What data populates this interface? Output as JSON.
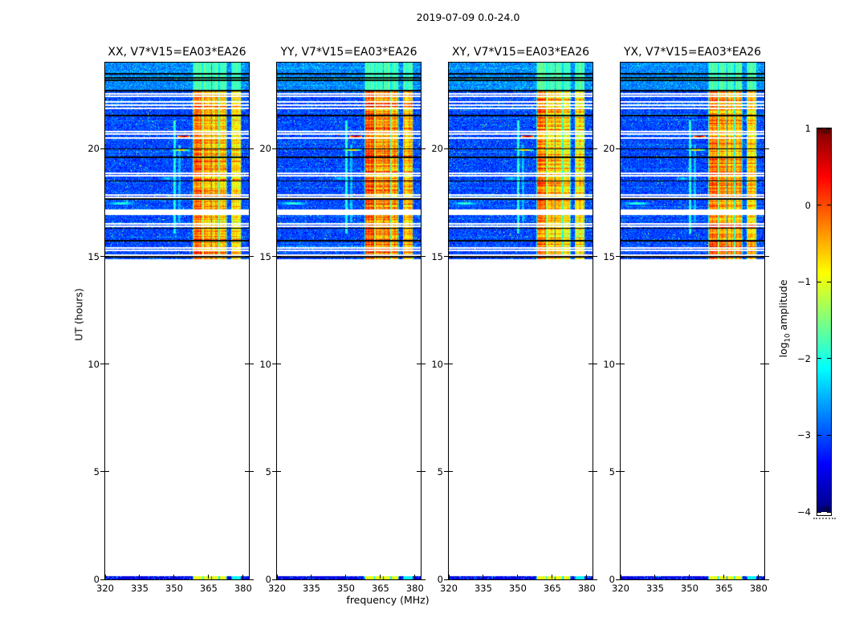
{
  "title": "2019-07-09 0.0-24.0",
  "axes": {
    "x_label": "frequency (MHz)",
    "y_label": "UT (hours)",
    "x_ticks": [
      320,
      335,
      350,
      365,
      380
    ],
    "y_ticks": [
      0,
      5,
      10,
      15,
      20
    ]
  },
  "colorbar": {
    "label_prefix": "log",
    "label_sub": "10",
    "label_suffix": " amplitude",
    "ticks": [
      1,
      0,
      -1,
      -2,
      -3,
      -4
    ],
    "range": [
      -4,
      1
    ],
    "colormap": "jet"
  },
  "chart_data": {
    "type": "heatmap",
    "description": "Dynamic spectra (amplitude vs frequency and time) for baseline V7*V15=EA03*EA26 in four polarization products; data present only between UT 14.9 and 24.0 plus a thin strip at UT 0.",
    "x_label": "frequency (MHz)",
    "y_label": "UT (hours)",
    "x_range": [
      320,
      382.5
    ],
    "y_range": [
      0,
      24
    ],
    "value_label": "log10 amplitude",
    "value_range": [
      -4,
      1
    ],
    "colormap": "jet",
    "panels": [
      {
        "pol": "XX",
        "label": "XX, V7*V15=EA03*EA26",
        "intensity": 1.0
      },
      {
        "pol": "YY",
        "label": "YY, V7*V15=EA03*EA26",
        "intensity": 1.1
      },
      {
        "pol": "XY",
        "label": "XY, V7*V15=EA03*EA26",
        "intensity": 0.88
      },
      {
        "pol": "YX",
        "label": "YX, V7*V15=EA03*EA26",
        "intensity": 1.0
      }
    ],
    "observed_time_range_ut": [
      14.88,
      24.0
    ],
    "bottom_strip_time_range_ut": [
      0,
      0.13
    ],
    "high_noise_time_range_ut": [
      22.72,
      24.0
    ],
    "noise_floor_log10": -3.4,
    "noise_spread_log10": 0.75,
    "rfi_bands_mhz": [
      {
        "f0": 358.5,
        "f1": 362.2,
        "level": -0.25
      },
      {
        "f0": 362.9,
        "f1": 365.9,
        "level": -0.5
      },
      {
        "f0": 366.5,
        "f1": 369.2,
        "level": -0.55
      },
      {
        "f0": 370.0,
        "f1": 372.6,
        "level": -0.6
      },
      {
        "f0": 375.2,
        "f1": 378.8,
        "level": -0.75
      }
    ],
    "dropout_times_ut": [
      22.55,
      22.42,
      22.17,
      22.02,
      21.88,
      20.8,
      20.68,
      20.5,
      18.86,
      18.76,
      17.85,
      17.74,
      17.14,
      17.05,
      16.96,
      16.5,
      16.4,
      15.4,
      15.28,
      15.06
    ],
    "flagged_times_ut": [
      23.48,
      23.3,
      23.18,
      22.7,
      21.54,
      20.0,
      19.6,
      18.5,
      17.72,
      17.66,
      16.3,
      15.73,
      14.98
    ],
    "features": [
      {
        "type": "vline",
        "f": 350.3,
        "t0": 16.05,
        "t1": 21.3,
        "level": -2.0
      },
      {
        "type": "vline",
        "f": 352.3,
        "t0": 16.6,
        "t1": 20.2,
        "level": -2.45
      },
      {
        "type": "burst",
        "t": 20.55,
        "f0": 351.5,
        "f1": 357.0,
        "peak_f": 354.3,
        "level": 0.9,
        "falloff": 0.55
      },
      {
        "type": "burst",
        "t": 19.95,
        "f0": 348.0,
        "f1": 357.0,
        "peak_f": 353.0,
        "level": -0.6,
        "falloff": 0.5
      },
      {
        "type": "burst",
        "t": 17.45,
        "f0": 320.2,
        "f1": 337.0,
        "peak_f": 327.0,
        "level": -1.85,
        "falloff": 0.18
      },
      {
        "type": "burst",
        "t": 18.62,
        "f0": 340.0,
        "f1": 352.0,
        "peak_f": 347.0,
        "level": -2.3,
        "falloff": 0.25
      }
    ]
  }
}
